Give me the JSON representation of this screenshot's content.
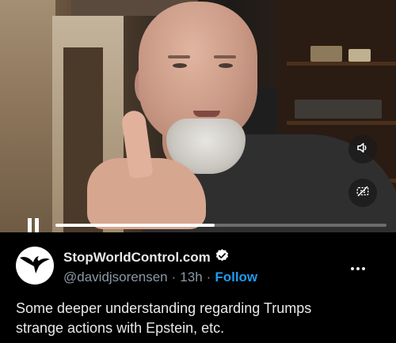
{
  "video": {
    "controls": {
      "progress_fraction": 0.48
    }
  },
  "tweet": {
    "display_name": "StopWorldControl.com",
    "verified": true,
    "handle": "@davidjsorensen",
    "separator": "·",
    "time_ago": "13h",
    "follow_label": "Follow",
    "text_line1": "Some deeper understanding regarding Trumps",
    "text_line2": "strange actions with Epstein, etc."
  },
  "icons": {
    "volume": "speaker-icon",
    "captions": "captions-off-icon",
    "verified": "verified-badge-icon",
    "more": "more-horizontal-icon",
    "avatar": "eagle-logo"
  },
  "colors": {
    "background": "#000000",
    "text": "#e7e9ea",
    "secondary_text": "#8b98a5",
    "link": "#1d9bf0"
  }
}
